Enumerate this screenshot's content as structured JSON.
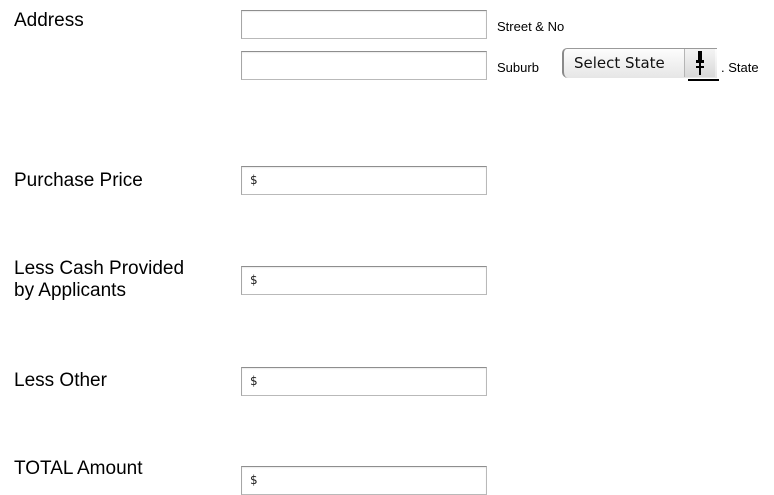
{
  "address": {
    "label": "Address",
    "street_input": {
      "value": "",
      "placeholder": ""
    },
    "street_label": "Street & No",
    "suburb_input": {
      "value": "",
      "placeholder": ""
    },
    "suburb_label": "Suburb",
    "state_select": {
      "selected": "Select State",
      "icon": "chevron-updown-icon"
    },
    "state_label": ". State"
  },
  "purchase_price": {
    "label": "Purchase Price",
    "prefix": "$",
    "value": ""
  },
  "less_cash": {
    "label": "Less Cash Provided\nby Applicants",
    "prefix": "$",
    "value": ""
  },
  "less_other": {
    "label": "Less Other",
    "prefix": "$",
    "value": ""
  },
  "total_amount": {
    "label": "TOTAL Amount",
    "prefix": "$",
    "value": ""
  }
}
